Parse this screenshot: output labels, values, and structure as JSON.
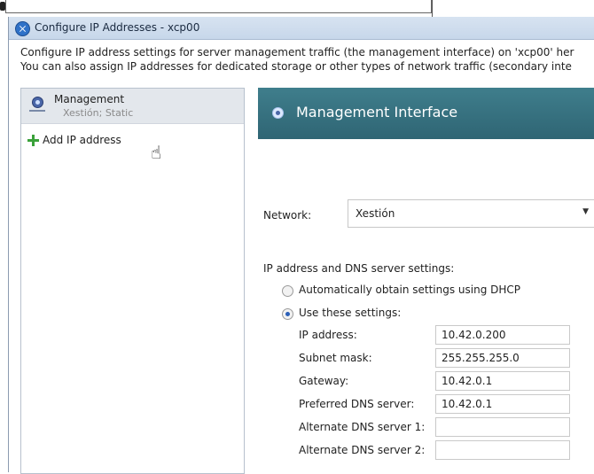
{
  "window": {
    "title": "Configure IP Addresses - xcp00",
    "description_line1": "Configure IP address settings for server management traffic (the management interface) on 'xcp00' her",
    "description_line2": "You can also assign IP addresses for dedicated storage or other types of network traffic (secondary inte"
  },
  "sidebar": {
    "selected": {
      "title": "Management",
      "subtitle": "Xestión; Static"
    },
    "add_label": "Add IP address"
  },
  "panel": {
    "header": "Management Interface",
    "network": {
      "label": "Network:",
      "value": "Xestión"
    },
    "ipdns_heading": "IP address and DNS server settings:",
    "radio_dhcp": "Automatically obtain settings using DHCP",
    "radio_static": "Use these settings:",
    "fields": [
      {
        "label": "IP address:",
        "value": "10.42.0.200"
      },
      {
        "label": "Subnet mask:",
        "value": "255.255.255.0"
      },
      {
        "label": "Gateway:",
        "value": "10.42.0.1"
      },
      {
        "label": "Preferred DNS server:",
        "value": "10.42.0.1"
      },
      {
        "label": "Alternate DNS server 1:",
        "value": ""
      },
      {
        "label": "Alternate DNS server 2:",
        "value": ""
      }
    ]
  },
  "colors": {
    "header_bg": "#336f7e",
    "titlebar_bg": "#cfddee",
    "selected_item_bg": "#e3e7ec"
  },
  "icons": [
    "close-circle-icon",
    "management-interface-icon",
    "add-plus-icon",
    "hand-pointer-cursor-icon"
  ]
}
